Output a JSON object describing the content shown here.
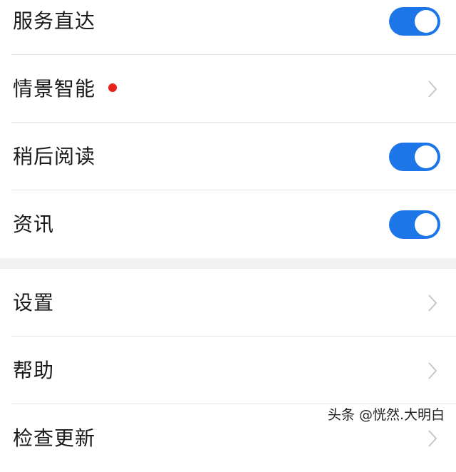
{
  "colors": {
    "accent": "#1d76e8",
    "badge": "#e8221b",
    "chevron": "#c7c7c7",
    "divider": "#e6e6e6",
    "section_gap": "#f1f1f1"
  },
  "group1": {
    "items": [
      {
        "label": "服务直达",
        "control": "toggle",
        "on": true
      },
      {
        "label": "情景智能",
        "control": "chevron",
        "badge": "red-dot"
      },
      {
        "label": "稍后阅读",
        "control": "toggle",
        "on": true
      },
      {
        "label": "资讯",
        "control": "toggle",
        "on": true
      }
    ]
  },
  "group2": {
    "items": [
      {
        "label": "设置",
        "control": "chevron"
      },
      {
        "label": "帮助",
        "control": "chevron"
      },
      {
        "label": "检查更新",
        "control": "chevron"
      }
    ]
  },
  "watermark": "头条 @恍然.大明白"
}
